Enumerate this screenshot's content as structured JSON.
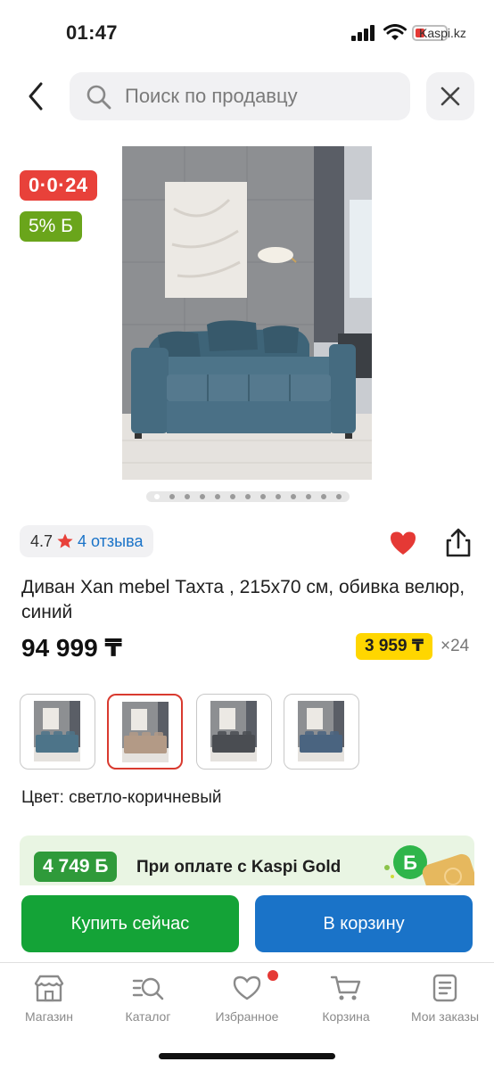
{
  "status": {
    "time": "01:47",
    "carrier": "Kaspi.kz"
  },
  "search": {
    "placeholder": "Поиск по продавцу"
  },
  "badges": {
    "installment": "0·0·24",
    "bonus": "5% Б"
  },
  "gallery": {
    "image_count": 13,
    "active_index": 0
  },
  "rating": {
    "value": "4.7",
    "reviews": "4 отзыва"
  },
  "product": {
    "title": "Диван Xan mebel Тахта , 215x70 см, обивка велюр, синий",
    "price": "94 999 ₸",
    "monthly": "3 959 ₸",
    "months": "×24",
    "color_label": "Цвет: светло-коричневый"
  },
  "variants": [
    {
      "name": "blue",
      "color": "#4d7489",
      "selected": false
    },
    {
      "name": "light-brown",
      "color": "#b39a86",
      "selected": true
    },
    {
      "name": "graphite",
      "color": "#4a4d52",
      "selected": false
    },
    {
      "name": "navy",
      "color": "#4a6480",
      "selected": false
    }
  ],
  "gold": {
    "amount": "4 749 Б",
    "text": "При оплате с Kaspi Gold"
  },
  "actions": {
    "buy": "Купить сейчас",
    "cart": "В корзину"
  },
  "nav": {
    "items": [
      {
        "label": "Магазин",
        "icon": "store-icon"
      },
      {
        "label": "Каталог",
        "icon": "catalog-search-icon"
      },
      {
        "label": "Избранное",
        "icon": "heart-outline-icon"
      },
      {
        "label": "Корзина",
        "icon": "cart-icon"
      },
      {
        "label": "Мои заказы",
        "icon": "orders-icon"
      }
    ]
  },
  "colors": {
    "red": "#e8413a",
    "green": "#14a337",
    "blue": "#1a73c8",
    "yellow": "#ffd600",
    "bonus_green": "#6aa51b"
  }
}
